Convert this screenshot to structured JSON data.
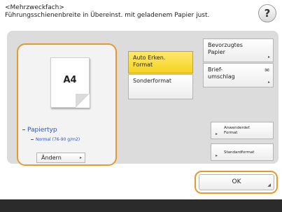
{
  "header": {
    "line1": "<Mehrzweckfach>",
    "line2": "Führungsschienenbreite in Übereinst. mit geladenem Papier just.",
    "help_label": "?"
  },
  "paper": {
    "size": "A4",
    "type_label": "Papiertyp",
    "type_value": "Normal (76-90 g/m2)",
    "change_label": "Ändern"
  },
  "buttons": {
    "auto": "Auto Erken. Format",
    "custom": "Sonderformat",
    "preferred": "Bevorzugtes Papier",
    "envelope": "Brief- umschlag",
    "user_defined": "Anwenderdef. Format",
    "standard": "Standardformat",
    "ok": "OK"
  }
}
